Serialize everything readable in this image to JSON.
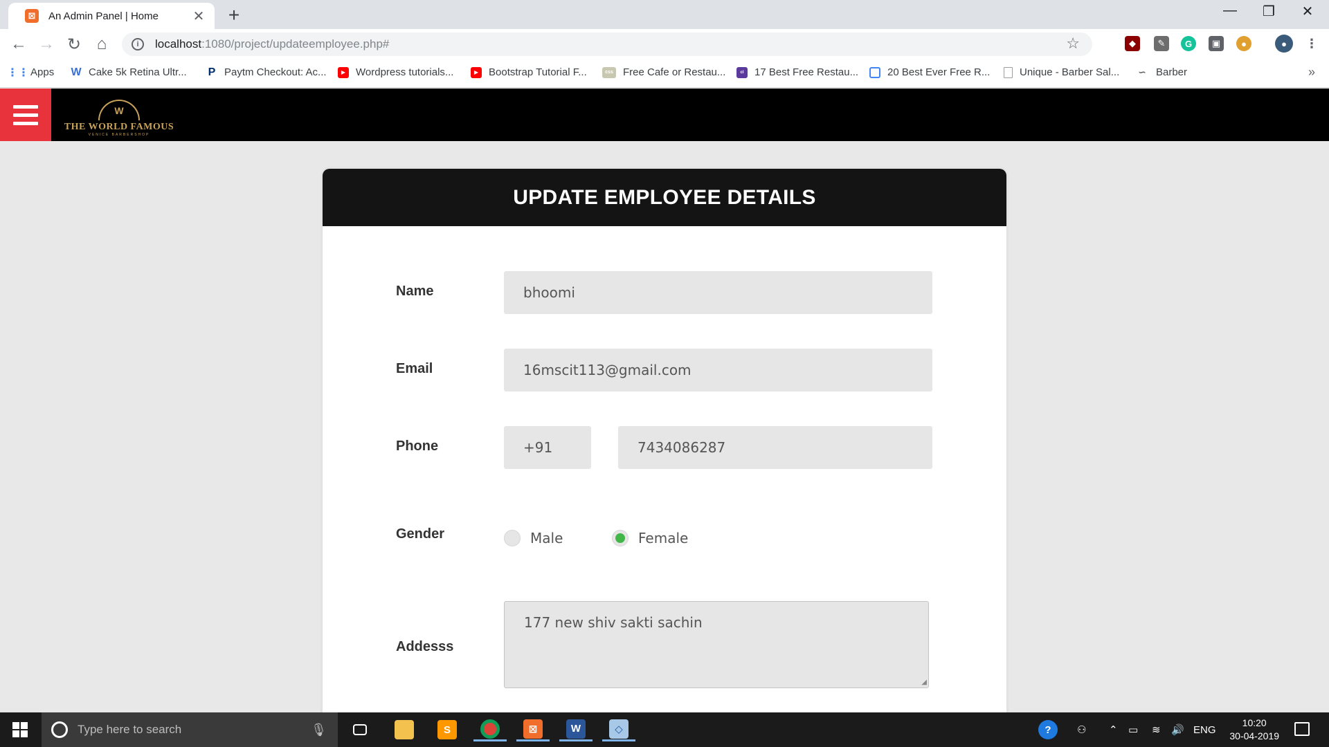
{
  "browser": {
    "tab_title": "An Admin Panel | Home",
    "tab_close": "✕",
    "new_tab": "+",
    "window_controls": {
      "minimize": "—",
      "restore": "❐",
      "close": "✕"
    },
    "nav": {
      "back": "←",
      "forward": "→",
      "reload": "↻",
      "home": "⌂"
    },
    "url_host": "localhost",
    "url_path": ":1080/project/updateemployee.php#",
    "star": "☆",
    "extensions": [
      "ublock-icon",
      "eyedropper-icon",
      "grammarly-icon",
      "extension-icon",
      "cookie-icon",
      "profile-avatar"
    ],
    "bookmarks": [
      {
        "label": "Apps",
        "icon": "apps-grid-icon",
        "color": "#4285f4"
      },
      {
        "label": "Cake 5k Retina Ultr...",
        "icon": "w-icon",
        "color": "#3b6fd8"
      },
      {
        "label": "Paytm Checkout: Ac...",
        "icon": "paytm-icon",
        "color": "#002e6e"
      },
      {
        "label": "Wordpress tutorials...",
        "icon": "youtube-icon",
        "color": "#ff0000"
      },
      {
        "label": "Bootstrap Tutorial F...",
        "icon": "youtube-icon",
        "color": "#ff0000"
      },
      {
        "label": "Free Cafe or Restau...",
        "icon": "css-icon",
        "color": "#c8c8b0"
      },
      {
        "label": "17 Best Free Restau...",
        "icon": "colorlib-icon",
        "color": "#5b3a9e"
      },
      {
        "label": "20 Best Ever Free R...",
        "icon": "bookmark-icon",
        "color": "#4285f4"
      },
      {
        "label": "Unique - Barber Sal...",
        "icon": "page-icon",
        "color": "#9e9e9e"
      },
      {
        "label": "Barber",
        "icon": "mustache-icon",
        "color": "#5f6368"
      }
    ],
    "bookmarks_more": "»"
  },
  "header": {
    "logo_crest": "W",
    "logo_text": "THE WORLD FAMOUS",
    "logo_sub": "VENICE BARBERSHOP"
  },
  "form": {
    "title": "UPDATE EMPLOYEE DETAILS",
    "name_label": "Name",
    "name_value": "bhoomi",
    "email_label": "Email",
    "email_value": "16mscit113@gmail.com",
    "phone_label": "Phone",
    "phone_code": "+91",
    "phone_value": "7434086287",
    "gender_label": "Gender",
    "gender_options": [
      "Male",
      "Female"
    ],
    "gender_selected": "Female",
    "address_label": "Addesss",
    "address_value": "177 new shiv sakti sachin"
  },
  "colors": {
    "header_bg": "#000000",
    "hamburger_bg": "#e8323c",
    "card_head_bg": "#141414",
    "radio_checked": "#42b649",
    "logo_gold": "#c9a259"
  },
  "taskbar": {
    "search_placeholder": "Type here to search",
    "apps": [
      "task-view-icon",
      "file-explorer-icon",
      "sublime-text-icon",
      "chrome-icon",
      "xampp-icon",
      "word-icon",
      "virtualbox-icon"
    ],
    "language": "ENG",
    "time": "10:20",
    "date": "30-04-2019"
  }
}
